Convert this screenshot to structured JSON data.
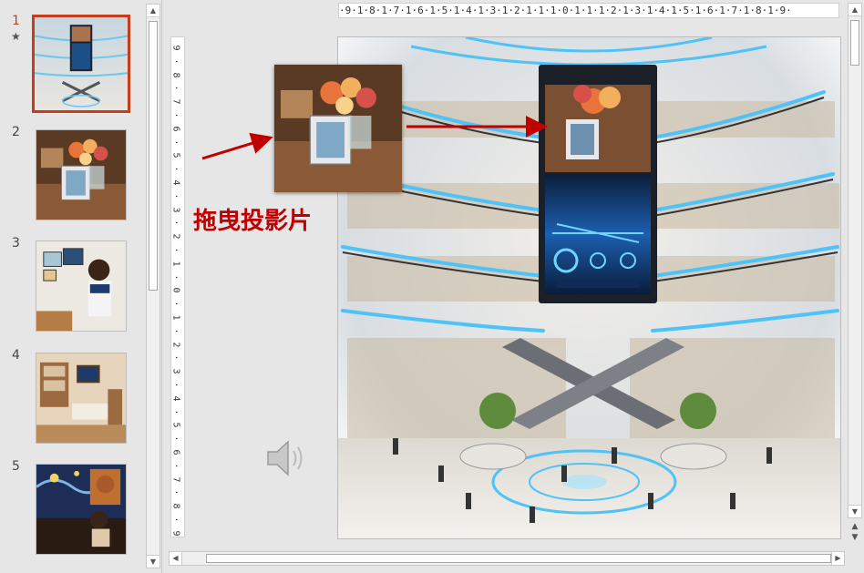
{
  "thumbnails": [
    {
      "number": "1",
      "active": true,
      "has_animation": true,
      "subject": "futuristic mall with central screen"
    },
    {
      "number": "2",
      "active": false,
      "subject": "flower vase with photo frame"
    },
    {
      "number": "3",
      "active": false,
      "subject": "girl in room with pictures"
    },
    {
      "number": "4",
      "active": false,
      "subject": "cozy living room"
    },
    {
      "number": "5",
      "active": false,
      "subject": "starry night cafe"
    }
  ],
  "thumb_star": "★",
  "ruler": {
    "horizontal": "·9·1·8·1·7·1·6·1·5·1·4·1·3·1·2·1·1·1·0·1·1·1·2·1·3·1·4·1·5·1·6·1·7·1·8·1·9·",
    "vertical_ticks": [
      "9",
      "·",
      "8",
      "·",
      "7",
      "·",
      "6",
      "·",
      "5",
      "·",
      "4",
      "·",
      "3",
      "·",
      "2",
      "·",
      "1",
      "·",
      "0",
      "·",
      "1",
      "·",
      "2",
      "·",
      "3",
      "·",
      "4",
      "·",
      "5",
      "·",
      "6",
      "·",
      "7",
      "·",
      "8",
      "·",
      "9"
    ]
  },
  "annotation": {
    "label": "拖曳投影片"
  },
  "scroll": {
    "up_arrow": "▲",
    "down_arrow": "▼",
    "left_arrow": "◀",
    "right_arrow": "▶",
    "prev_slide": "▲",
    "next_slide": "▼"
  },
  "colors": {
    "accent": "#c43e1c",
    "annotation_red": "#c00000",
    "neon_blue": "#4fc3f7"
  },
  "icons": {
    "audio": "speaker-icon"
  }
}
